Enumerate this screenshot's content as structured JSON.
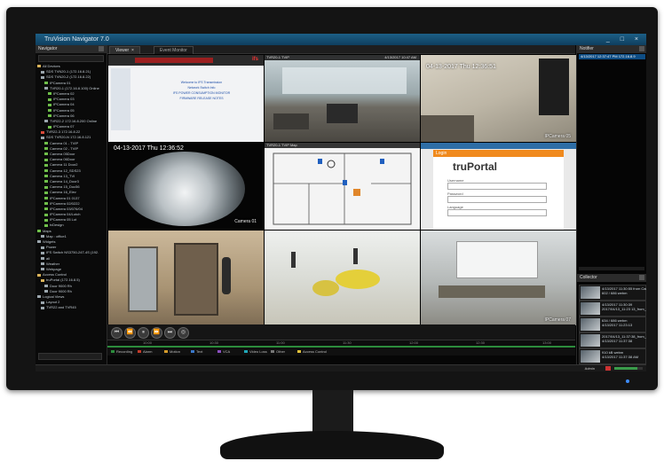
{
  "window": {
    "title": "TruVision Navigator 7.0",
    "controls": "_ □ ×"
  },
  "navigator": {
    "title": "Navigator",
    "tree": [
      {
        "label": "All Devices",
        "indent": 0,
        "color": "#d9b35a"
      },
      {
        "label": "SDS TVN20-1 (172.16.8.21)",
        "indent": 1,
        "color": "#9ba6ad"
      },
      {
        "label": "SDS TVN20-2 (172.16.8.22)",
        "indent": 1,
        "color": "#9ba6ad"
      },
      {
        "label": "IPCamera 01",
        "indent": 2,
        "color": "#6fbf4a"
      },
      {
        "label": "TVR20-1 (172.16.8.100) Online",
        "indent": 2,
        "color": "#9ba6ad"
      },
      {
        "label": "IPCamera 02",
        "indent": 3,
        "color": "#6fbf4a"
      },
      {
        "label": "IPCamera 03",
        "indent": 3,
        "color": "#6fbf4a"
      },
      {
        "label": "IPCamera 04",
        "indent": 3,
        "color": "#6fbf4a"
      },
      {
        "label": "IPCamera 05",
        "indent": 3,
        "color": "#6fbf4a"
      },
      {
        "label": "IPCamera 06",
        "indent": 3,
        "color": "#6fbf4a"
      },
      {
        "label": "TVR22-2 172.16.8.200 Online",
        "indent": 2,
        "color": "#9ba6ad"
      },
      {
        "label": "IPCamera 07",
        "indent": 3,
        "color": "#6fbf4a"
      },
      {
        "label": "TVR22-3 172.16.8.22",
        "indent": 1,
        "color": "#d94a3a"
      },
      {
        "label": "SDS TVR20-N 172.16.8.121",
        "indent": 1,
        "color": "#9ba6ad"
      },
      {
        "label": "Camera 01 - TVIP",
        "indent": 2,
        "color": "#6fbf4a"
      },
      {
        "label": "Camera 02 - TVIP",
        "indent": 2,
        "color": "#6fbf4a"
      },
      {
        "label": "Camera 05Door",
        "indent": 2,
        "color": "#6fbf4a"
      },
      {
        "label": "Camera 06Door",
        "indent": 2,
        "color": "#6fbf4a"
      },
      {
        "label": "Camera 11 Door2",
        "indent": 2,
        "color": "#6fbf4a"
      },
      {
        "label": "Camera 12_SDS23",
        "indent": 2,
        "color": "#6fbf4a"
      },
      {
        "label": "Camera 13_TVI",
        "indent": 2,
        "color": "#6fbf4a"
      },
      {
        "label": "Camera 14_Door3",
        "indent": 2,
        "color": "#6fbf4a"
      },
      {
        "label": "Camera 15_Doc56",
        "indent": 2,
        "color": "#6fbf4a"
      },
      {
        "label": "Camera 16_Elev",
        "indent": 2,
        "color": "#6fbf4a"
      },
      {
        "label": "IPCamera 01 0137",
        "indent": 2,
        "color": "#6fbf4a"
      },
      {
        "label": "IPCamera 02/0222",
        "indent": 2,
        "color": "#6fbf4a"
      },
      {
        "label": "IPCamera 03/076/04",
        "indent": 2,
        "color": "#6fbf4a"
      },
      {
        "label": "IPCamera 04/Lotch",
        "indent": 2,
        "color": "#6fbf4a"
      },
      {
        "label": "IPCamera 05 Lot",
        "indent": 2,
        "color": "#6fbf4a"
      },
      {
        "label": "tvDesign",
        "indent": 2,
        "color": "#6fbf4a"
      },
      {
        "label": "Maps",
        "indent": 0,
        "color": "#6fbf4a"
      },
      {
        "label": "Map : office1",
        "indent": 1,
        "color": "#9ba6ad"
      },
      {
        "label": "Widgets",
        "indent": 0,
        "color": "#9ba6ad"
      },
      {
        "label": "Power",
        "indent": 1,
        "color": "#9ba6ad"
      },
      {
        "label": "IFS Switch NS3750-24T-4S (192.",
        "indent": 1,
        "color": "#9ba6ad"
      },
      {
        "label": "all",
        "indent": 1,
        "color": "#9ba6ad"
      },
      {
        "label": "Weather",
        "indent": 1,
        "color": "#9ba6ad"
      },
      {
        "label": "Webpage",
        "indent": 1,
        "color": "#9ba6ad"
      },
      {
        "label": "Access Control",
        "indent": 0,
        "color": "#d9b35a"
      },
      {
        "label": "truPortal (172.16.8.5)",
        "indent": 1,
        "color": "#d9b35a"
      },
      {
        "label": "Door 9000 Rh",
        "indent": 2,
        "color": "#9ba6ad"
      },
      {
        "label": "Door 9000 Rh",
        "indent": 2,
        "color": "#9ba6ad"
      },
      {
        "label": "Logical Views",
        "indent": 0,
        "color": "#9ba6ad"
      },
      {
        "label": "Layout 2",
        "indent": 1,
        "color": "#9ba6ad"
      },
      {
        "label": "TVR22 and TVR45",
        "indent": 1,
        "color": "#9ba6ad"
      }
    ]
  },
  "tabs": [
    {
      "label": "Viewer",
      "active": true
    },
    {
      "label": "Event Monitor",
      "active": false
    }
  ],
  "cells": {
    "c1": {
      "title": "",
      "brand": "ifs",
      "lines": [
        "Welcome to IFS Transmission",
        "Network Switch Info",
        "IFS POWER CONSUMPTION MONITOR",
        "FIRMWARE RELEASE NOTES"
      ]
    },
    "c2": {
      "title": "TVR20-1 TVIP",
      "stamp": "4/13/2017 10:47 AM"
    },
    "c3": {
      "title": "",
      "stamp": "04-13-2017 Thu 12:36:51",
      "camera": "IPCamera 05"
    },
    "c4": {
      "stamp": "04-13-2017 Thu 12:36:52",
      "camera": "Camera 01"
    },
    "c5": {
      "title": "TVR20-1 TVIP Map"
    },
    "c6": {
      "header": "Login",
      "brand": "truPortal",
      "fields": [
        "Username",
        "Password",
        "Language"
      ]
    },
    "c7": {
      "camera": ""
    },
    "c8": {
      "camera": ""
    },
    "c9": {
      "camera": "IPCamera 07"
    }
  },
  "controls": {
    "buttons": [
      "⏮",
      "⏪",
      "⏸",
      "⏩",
      "⏭",
      "◎"
    ]
  },
  "timeline": {
    "ticks": [
      "10:00",
      "10:30",
      "11:00",
      "11:30",
      "12:00",
      "12:30",
      "13:00"
    ]
  },
  "legend": [
    {
      "label": "Recording",
      "color": "#2c8c3c"
    },
    {
      "label": "Alarm",
      "color": "#c43a2a"
    },
    {
      "label": "Motion",
      "color": "#d39a2a"
    },
    {
      "label": "Text",
      "color": "#3a78c9"
    },
    {
      "label": "VCA",
      "color": "#8b4fc0"
    },
    {
      "label": "Video Loss",
      "color": "#20a7b8"
    },
    {
      "label": "Other",
      "color": "#777777"
    },
    {
      "label": "Access Control",
      "color": "#e0c13a"
    }
  ],
  "notifier": {
    "title": "Notifier",
    "row": "4/13/2017 12:37:47 PM 172.16.8.9"
  },
  "collector": {
    "title": "Collector",
    "items": [
      {
        "line1": "4/13/2017 11:30:55 from Came",
        "line2": "602 / 686 webm"
      },
      {
        "line1": "4/13/2017 11:30:39",
        "line2": "2017/04/13_11:23 13_from_Came"
      },
      {
        "line1": "634 / 686 webm",
        "line2": "4/13/2017 11:23:13"
      },
      {
        "line1": "2017/04/13_11:37:38_from_Came",
        "line2": "4/13/2017 11:37:38"
      },
      {
        "line1": "910 kB webm",
        "line2": "4/13/2017 11:37:38 AM"
      }
    ]
  },
  "status": {
    "user": "Admin",
    "volume": "80"
  }
}
